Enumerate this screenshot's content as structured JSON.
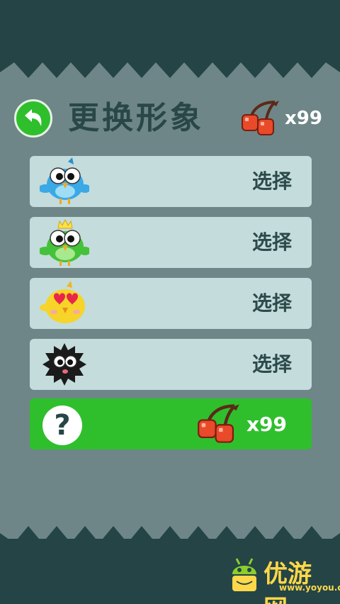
{
  "header": {
    "title": "更换形象",
    "currency_icon": "cherry-icon",
    "currency_count": "x99"
  },
  "characters": [
    {
      "name": "blue-bird",
      "color": "#3aa9e6",
      "action": "选择"
    },
    {
      "name": "green-crowned-bird",
      "color": "#44c23a",
      "action": "选择"
    },
    {
      "name": "yellow-heart-eyes-chick",
      "color": "#f6d429",
      "action": "选择"
    },
    {
      "name": "black-fuzzball",
      "color": "#1b1b1b",
      "action": "选择"
    }
  ],
  "locked": {
    "symbol": "?",
    "price_icon": "cherry-icon",
    "price": "x99"
  },
  "watermark": {
    "text": "优游网",
    "url": "www.yoyou.com"
  },
  "colors": {
    "background": "#244446",
    "panel": "#6e8687",
    "row": "#c4dcdc",
    "accent_green": "#2fbf2d",
    "cherry": "#e84a2a"
  }
}
